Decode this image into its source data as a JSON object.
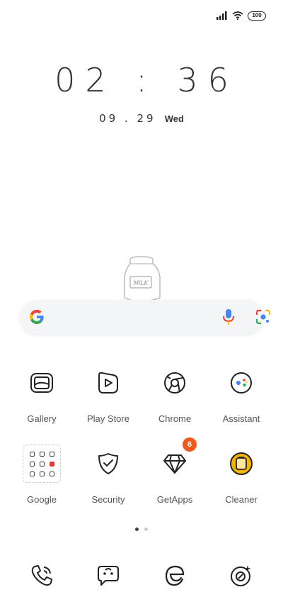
{
  "status_bar": {
    "icons": [
      "signal-icon",
      "wifi-icon",
      "battery-icon"
    ],
    "battery_level": "100"
  },
  "lockscreen": {
    "time": "02 : 36",
    "date": "09 . 29",
    "weekday": "Wed"
  },
  "widget": {
    "label": "MiLK"
  },
  "search": {
    "icons": [
      "google-g-icon",
      "mic-icon",
      "lens-icon"
    ]
  },
  "apps_row1": [
    {
      "label": "Gallery",
      "icon": "gallery-icon"
    },
    {
      "label": "Play Store",
      "icon": "play-store-icon"
    },
    {
      "label": "Chrome",
      "icon": "chrome-icon"
    },
    {
      "label": "Assistant",
      "icon": "assistant-icon"
    }
  ],
  "apps_row2": [
    {
      "label": "Google",
      "icon": "google-folder-icon"
    },
    {
      "label": "Security",
      "icon": "security-icon"
    },
    {
      "label": "GetApps",
      "icon": "getapps-icon",
      "badge": "6"
    },
    {
      "label": "Cleaner",
      "icon": "cleaner-icon"
    }
  ],
  "page_indicator": {
    "pages": 2,
    "active": 1
  },
  "dock": [
    "phone-icon",
    "messages-icon",
    "browser-icon",
    "camera-icon"
  ],
  "colors": {
    "badge": "#f25a1c",
    "cleaner_accent": "#f5b400"
  }
}
